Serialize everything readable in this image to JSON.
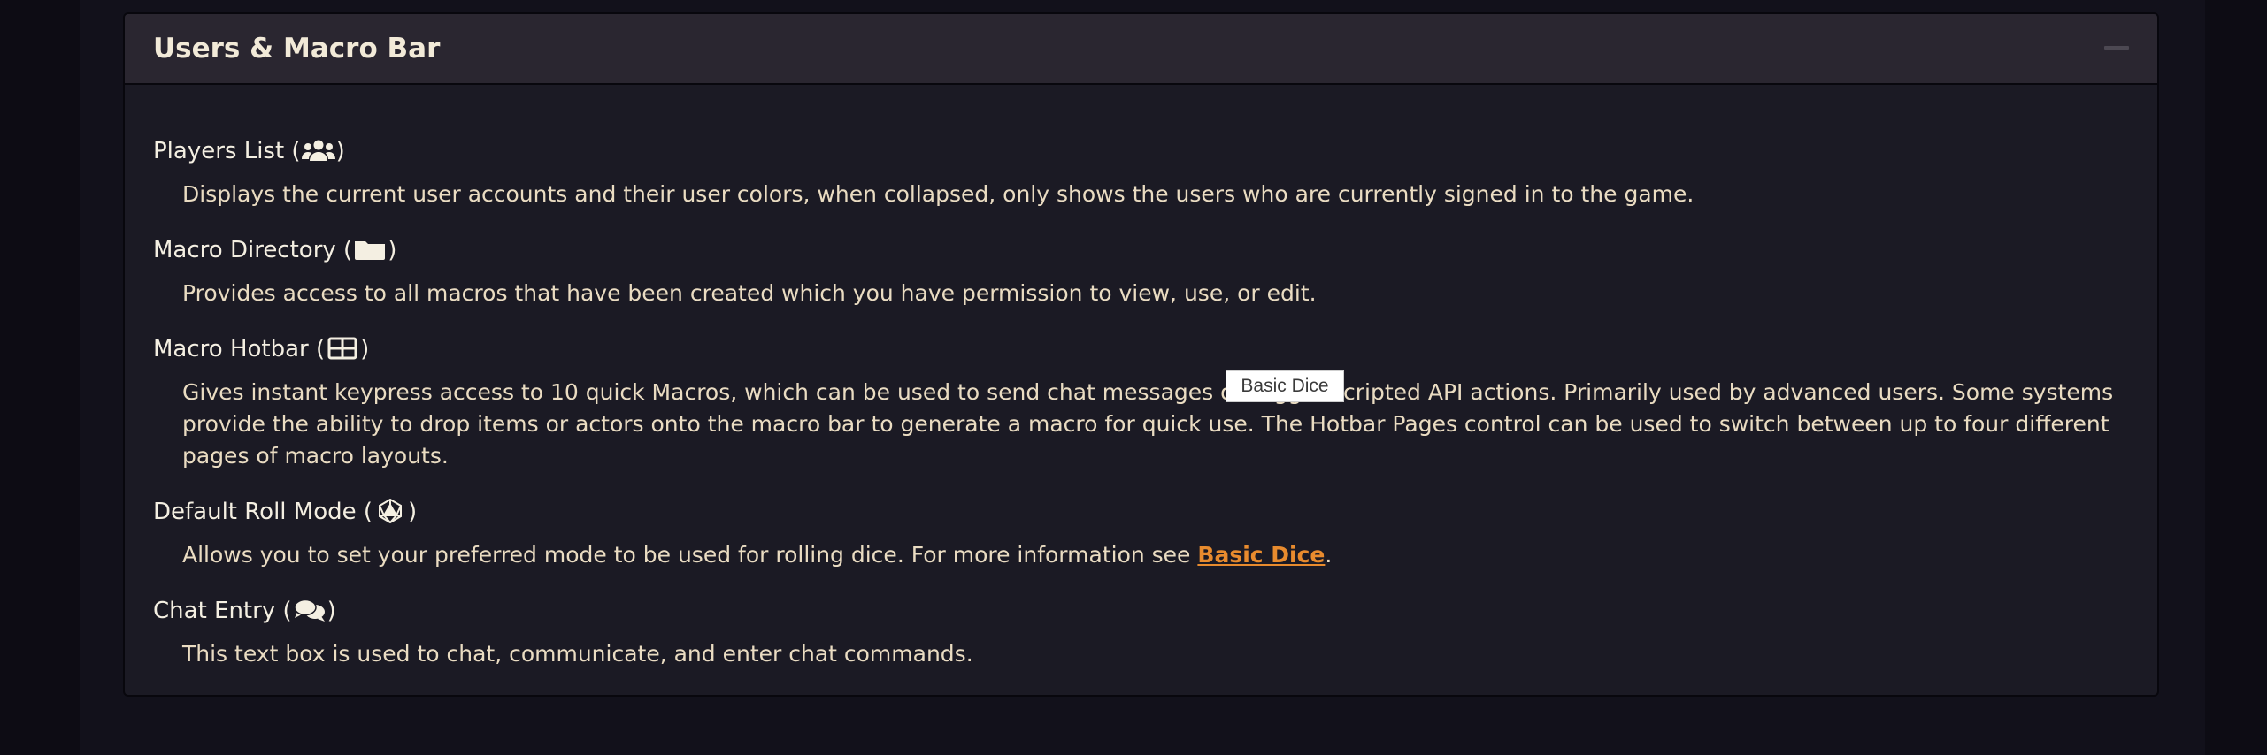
{
  "panel": {
    "title": "Users & Macro Bar",
    "collapse_icon": "minus-icon"
  },
  "entries": [
    {
      "title": "Players List",
      "icon": "users-icon",
      "description": "Displays the current user accounts and their user colors, when collapsed, only shows the users who are currently signed in to the game."
    },
    {
      "title": "Macro Directory",
      "icon": "folder-icon",
      "description": "Provides access to all macros that have been created which you have permission to view, use, or edit."
    },
    {
      "title": "Macro Hotbar",
      "icon": "table-icon",
      "description_lines": [
        "Gives instant keypress access to 10 quick Macros, which can be used to send chat messages or trigger scripted API actions. Primarily used by advanced users. Some systems",
        "provide the ability to drop items or actors onto the macro bar to generate a macro for quick use. The Hotbar Pages control can be used to switch between up to four different",
        "pages of macro layouts."
      ]
    },
    {
      "title": "Default Roll Mode",
      "icon": "dice-d20-icon",
      "description_prefix": "Allows you to set your preferred mode to be used for rolling dice. For more information see ",
      "link": "Basic Dice",
      "description_suffix": "."
    },
    {
      "title": "Chat Entry",
      "icon": "comments-icon",
      "description": "This text box is used to chat, communicate, and enter chat commands."
    }
  ],
  "tooltip": "Basic Dice",
  "colors": {
    "background": "#0d0c14",
    "panel": "#1b1a24",
    "header": "#2a2630",
    "title_text": "#f2ead8",
    "body_text": "#eadcc2",
    "link": "#e88b2e"
  }
}
